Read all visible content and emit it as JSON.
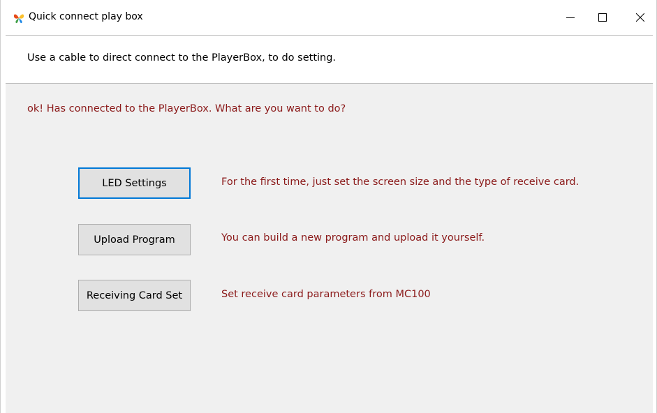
{
  "window": {
    "title": "Quick connect play box",
    "app_icon": "butterfly-app-icon",
    "controls": {
      "minimize": "minimize-icon",
      "maximize": "maximize-icon",
      "close": "close-icon"
    }
  },
  "header": {
    "description": "Use a cable to direct connect to the PlayerBox, to do setting."
  },
  "main": {
    "status": "ok! Has connected to the PlayerBox.  What are you want to do?",
    "actions": [
      {
        "label": "LED Settings",
        "description": "For the first time, just set the screen size and the type of receive card."
      },
      {
        "label": "Upload Program",
        "description": "You can build a new program and upload it yourself."
      },
      {
        "label": "Receiving Card Set",
        "description": "Set receive card parameters from MC100"
      }
    ]
  },
  "colors": {
    "accent_focus": "#0078d7",
    "status_text": "#8b1a1a",
    "panel_bg": "#f0f0f0",
    "button_bg": "#e1e1e1"
  }
}
